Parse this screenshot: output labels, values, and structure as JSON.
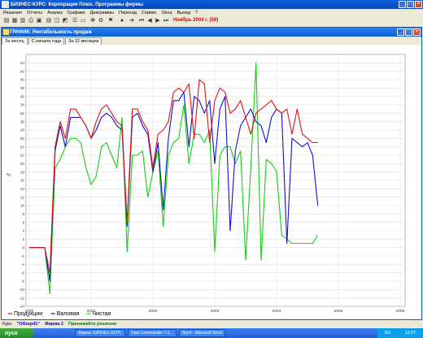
{
  "app": {
    "title": "БИЗНЕС-КУРС: Корпорация Плюс. Программы фирмы"
  },
  "menu": [
    "Решения",
    "Отчеты",
    "Анализ",
    "Графики",
    "Диаграммы",
    "Переход",
    "Сервис",
    "Окна",
    "Выход",
    "?"
  ],
  "toolbar": {
    "period": "Ноябрь 2004 г. (59)"
  },
  "chart_window": {
    "title": "ГРАФИК: Рентабельность продаж",
    "tabs": [
      "За месяц",
      "С начала года",
      "За 12 месяцев"
    ],
    "active_tab": 0
  },
  "chart_data": {
    "type": "line",
    "title": "",
    "xlabel": "",
    "ylabel": "%",
    "ylim": [
      -14,
      46
    ],
    "yticks": [
      -14,
      -12,
      -10,
      -8,
      -6,
      -4,
      -2,
      0,
      2,
      4,
      6,
      8,
      10,
      12,
      14,
      16,
      18,
      20,
      22,
      24,
      26,
      28,
      30,
      32,
      34,
      36,
      38,
      40,
      42,
      44
    ],
    "xlim": [
      2000,
      2006
    ],
    "xticks": [
      "2000",
      "2001",
      "2002",
      "2003",
      "2004",
      "2005",
      "2006"
    ],
    "grid": true,
    "legend_position": "bottom-left",
    "x": [
      2000.0,
      2000.083,
      2000.167,
      2000.25,
      2000.333,
      2000.417,
      2000.5,
      2000.583,
      2000.667,
      2000.75,
      2000.833,
      2000.917,
      2001.0,
      2001.083,
      2001.167,
      2001.25,
      2001.333,
      2001.417,
      2001.5,
      2001.583,
      2001.667,
      2001.75,
      2001.833,
      2001.917,
      2002.0,
      2002.083,
      2002.167,
      2002.25,
      2002.333,
      2002.417,
      2002.5,
      2002.583,
      2002.667,
      2002.75,
      2002.833,
      2002.917,
      2003.0,
      2003.083,
      2003.167,
      2003.25,
      2003.333,
      2003.417,
      2003.5,
      2003.583,
      2003.667,
      2003.75,
      2003.833,
      2003.917,
      2004.0,
      2004.083,
      2004.167,
      2004.25,
      2004.333,
      2004.417,
      2004.5,
      2004.583,
      2004.667,
      2004.75,
      2004.833
    ],
    "series": [
      {
        "name": "Продукции",
        "color": "#e01010",
        "values": [
          0,
          0,
          0,
          0,
          -6,
          24,
          30,
          26,
          33,
          33,
          31,
          29,
          26,
          30,
          33,
          34,
          32,
          30,
          29,
          6,
          33,
          33,
          30,
          28,
          19,
          27,
          28,
          30,
          37,
          38,
          37,
          39,
          26,
          40,
          39,
          25,
          35,
          38,
          37,
          32,
          33,
          35,
          31,
          27,
          32,
          33,
          34,
          35,
          33,
          32,
          33,
          27,
          33,
          27,
          26,
          25,
          25
        ]
      },
      {
        "name": "Валовая",
        "color": "#1010d0",
        "values": [
          0,
          0,
          0,
          0,
          -8,
          23,
          29,
          24,
          31,
          31,
          31,
          29,
          26,
          28,
          31,
          32,
          31,
          29,
          28,
          5,
          31,
          32,
          29,
          27,
          18,
          25,
          9,
          26,
          35,
          35,
          37,
          24,
          36,
          35,
          32,
          35,
          20,
          33,
          36,
          4,
          23,
          29,
          31,
          33,
          30,
          29,
          25,
          31,
          33,
          32,
          1,
          26,
          25,
          24,
          25,
          22,
          10
        ]
      },
      {
        "name": "Чистая",
        "color": "#10d010",
        "values": [
          0,
          0,
          0,
          0,
          -11,
          19,
          21,
          24,
          26,
          26,
          25,
          19,
          15,
          17,
          24,
          25,
          22,
          19,
          31,
          -1,
          22,
          22,
          23,
          12,
          18,
          23,
          5,
          22,
          25,
          26,
          34,
          20,
          27,
          27,
          25,
          28,
          -1,
          22,
          24,
          24,
          20,
          23,
          -3,
          19,
          44,
          -3,
          21,
          20,
          18,
          3,
          2,
          1,
          1,
          1,
          1,
          1,
          3
        ]
      }
    ]
  },
  "status": {
    "kurs_label": "Курс",
    "kurs_value": "\"Обзор41\"",
    "firm": "Фирма 2",
    "decision": "Принимайте решения"
  },
  "taskbar": {
    "start": "пуск",
    "items": [
      "Фирма: БИЗНЕС-КУРС",
      "Total Commander 7.0...",
      "Doc4 - Microsoft Word"
    ],
    "lang": "RU",
    "time": "12:07"
  }
}
